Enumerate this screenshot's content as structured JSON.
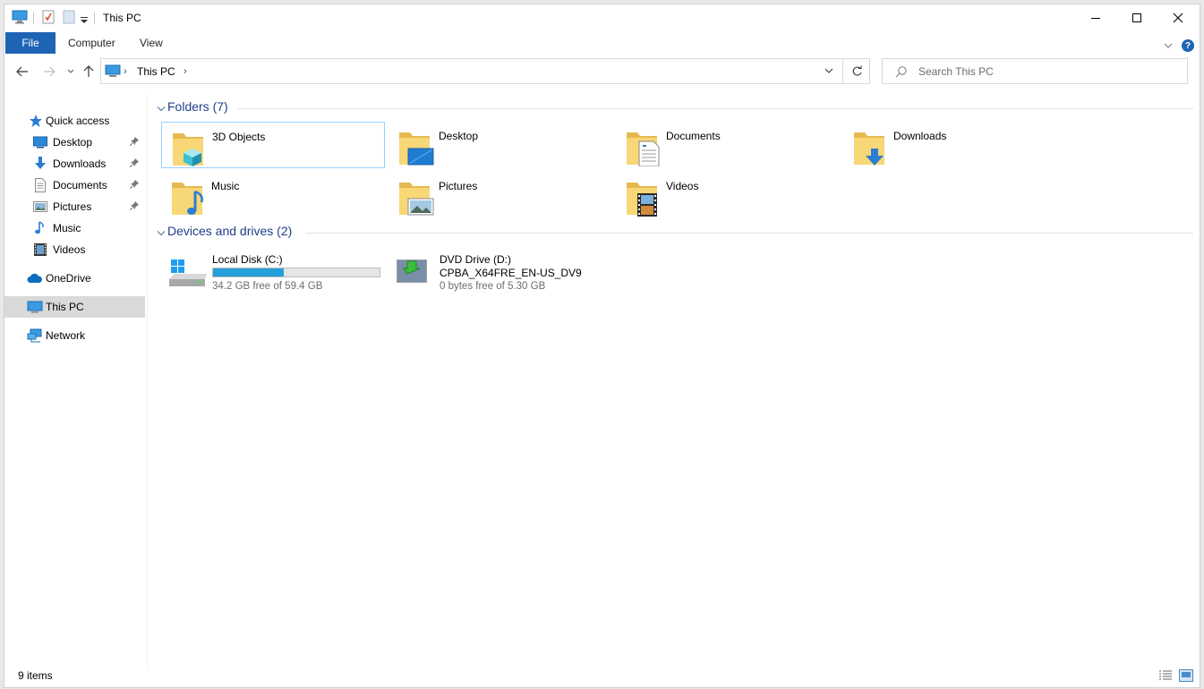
{
  "window": {
    "title": "This PC"
  },
  "ribbon": {
    "tabs": [
      "File",
      "Computer",
      "View"
    ]
  },
  "address": {
    "path": "This PC"
  },
  "search": {
    "placeholder": "Search This PC"
  },
  "sidebar": {
    "items": [
      {
        "label": "Quick access",
        "icon": "star-icon"
      },
      {
        "label": "Desktop",
        "icon": "desktop-icon",
        "pinned": true
      },
      {
        "label": "Downloads",
        "icon": "download-icon",
        "pinned": true
      },
      {
        "label": "Documents",
        "icon": "document-icon",
        "pinned": true
      },
      {
        "label": "Pictures",
        "icon": "pictures-icon",
        "pinned": true
      },
      {
        "label": "Music",
        "icon": "music-icon"
      },
      {
        "label": "Videos",
        "icon": "video-icon"
      },
      {
        "label": "OneDrive",
        "icon": "cloud-icon"
      },
      {
        "label": "This PC",
        "icon": "computer-icon",
        "selected": true
      },
      {
        "label": "Network",
        "icon": "network-icon"
      }
    ]
  },
  "groups": {
    "folders_title": "Folders (7)",
    "devices_title": "Devices and drives (2)"
  },
  "folders": [
    {
      "name": "3D Objects",
      "icon": "3d-objects-folder-icon"
    },
    {
      "name": "Desktop",
      "icon": "desktop-folder-icon"
    },
    {
      "name": "Documents",
      "icon": "documents-folder-icon"
    },
    {
      "name": "Downloads",
      "icon": "downloads-folder-icon"
    },
    {
      "name": "Music",
      "icon": "music-folder-icon"
    },
    {
      "name": "Pictures",
      "icon": "pictures-folder-icon"
    },
    {
      "name": "Videos",
      "icon": "videos-folder-icon"
    }
  ],
  "drives": [
    {
      "name": "Local Disk (C:)",
      "info": "34.2 GB free of 59.4 GB",
      "used_fraction": 0.424,
      "icon": "hard-disk-icon"
    },
    {
      "name": "DVD Drive (D:)",
      "label": "CPBA_X64FRE_EN-US_DV9",
      "info": "0 bytes free of 5.30 GB",
      "icon": "dvd-drive-icon"
    }
  ],
  "status": {
    "item_count": "9 items"
  },
  "colors": {
    "accent": "#1e64b4",
    "selection": "#d9d9d9",
    "progress": "#26a0da",
    "group_title": "#1f3e8c"
  }
}
